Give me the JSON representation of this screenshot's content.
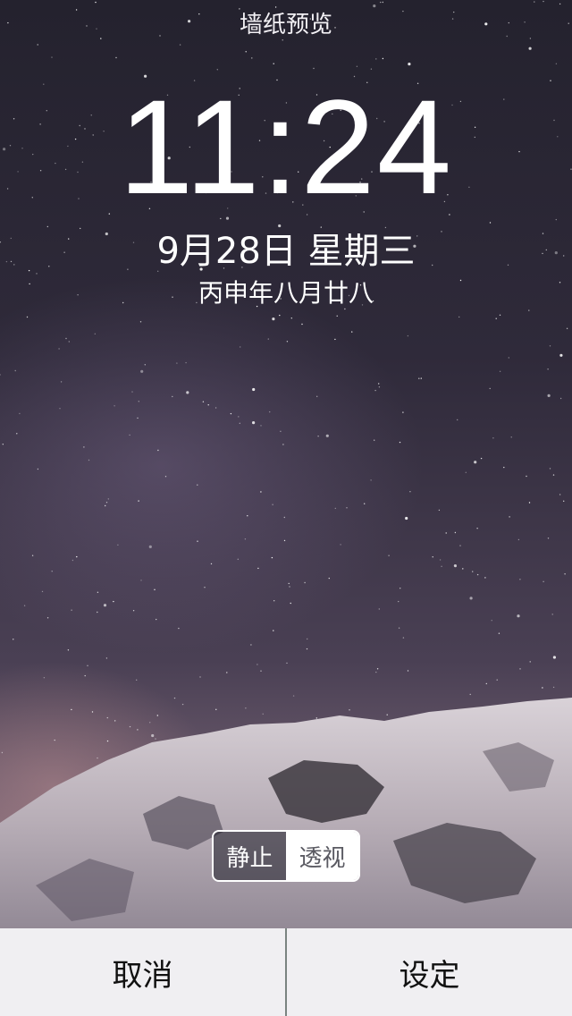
{
  "header": {
    "title": "墙纸预览"
  },
  "lockscreen": {
    "time": "11:24",
    "date": "9月28日 星期三",
    "lunar_date": "丙申年八月廿八"
  },
  "mode_switch": {
    "options": [
      "静止",
      "透视"
    ],
    "selected": "静止"
  },
  "actions": {
    "cancel_label": "取消",
    "set_label": "设定"
  },
  "colors": {
    "bar_background": "#f0eff2",
    "divider": "#7a8480"
  }
}
